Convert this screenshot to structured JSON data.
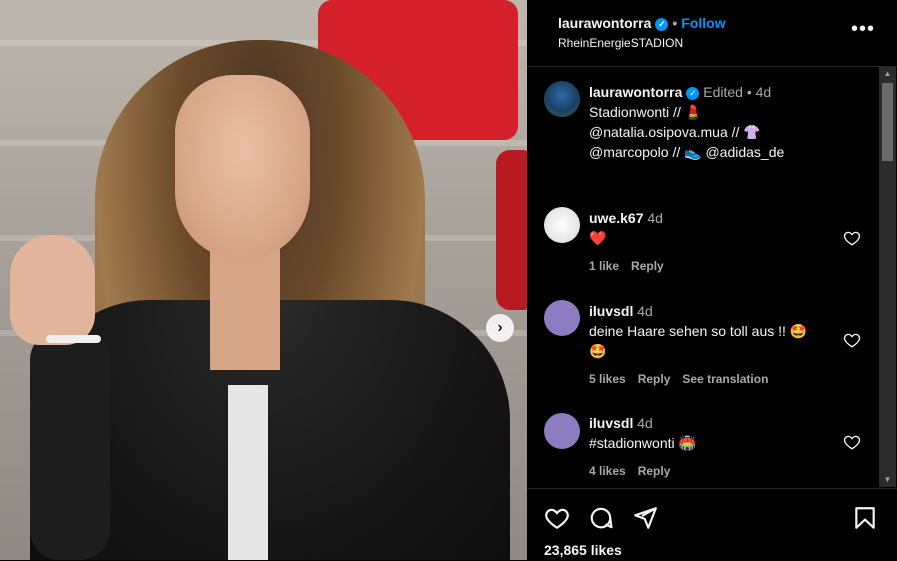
{
  "header": {
    "username": "laurawontorra",
    "follow_label": "Follow",
    "location": "RheinEnergieSTADION"
  },
  "caption": {
    "username": "laurawontorra",
    "edited": "Edited",
    "time": "4d",
    "line1": "Stadionwonti // 💄",
    "line2": "@natalia.osipova.mua // 👚",
    "line3": "@marcopolo // 👟 @adidas_de"
  },
  "comments": [
    {
      "username": "uwe.k67",
      "time": "4d",
      "text": "❤️",
      "likes": "1 like",
      "reply": "Reply"
    },
    {
      "username": "iluvsdl",
      "time": "4d",
      "text": "deine Haare sehen so toll aus !! 🤩",
      "text2": "🤩",
      "likes": "5 likes",
      "reply": "Reply",
      "translate": "See translation"
    },
    {
      "username": "iluvsdl",
      "time": "4d",
      "text": "#stadionwonti 🏟️",
      "likes": "4 likes",
      "reply": "Reply"
    }
  ],
  "footer": {
    "likes": "23,865 likes"
  },
  "icons": {
    "like": "heart-icon",
    "comment": "comment-icon",
    "share": "send-icon",
    "save": "bookmark-icon",
    "more": "more-icon",
    "next": "chevron-right-icon"
  },
  "colors": {
    "accent": "#0095f6",
    "background": "#000000",
    "heart_red": "#ed1c24"
  }
}
